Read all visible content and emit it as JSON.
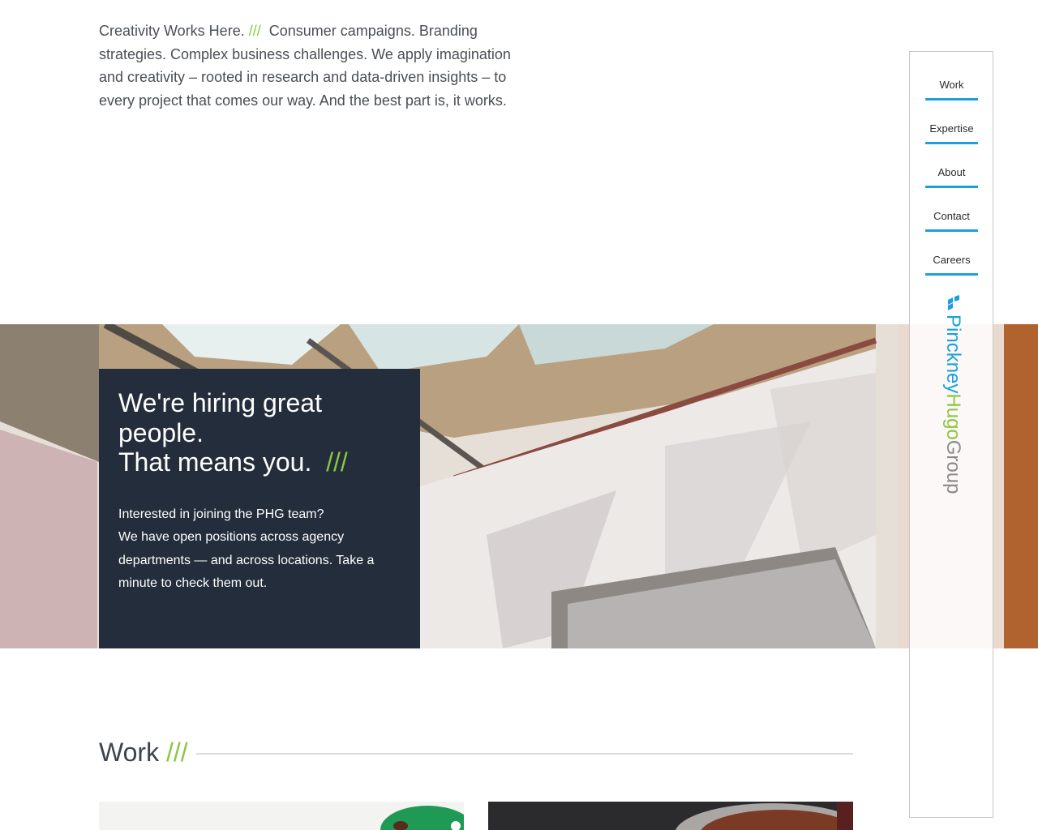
{
  "intro": {
    "lead": "Creativity Works Here.",
    "slashes": "///",
    "text": "Consumer campaigns. Branding strategies. Complex business challenges. We apply imagination and creativity – rooted in research and data-driven insights – to every project that comes our way. And the best part is, it works."
  },
  "hero": {
    "title_line1": "We're hiring great people.",
    "title_line2": "That means you.",
    "title_slashes": "///",
    "body_line1": "Interested in joining the PHG team?",
    "body_line2": "We have open positions across agency departments — and across locations. Take a minute to check them out."
  },
  "work": {
    "heading": "Work",
    "slashes": "///"
  },
  "nav": {
    "items": [
      {
        "label": "Work"
      },
      {
        "label": "Expertise"
      },
      {
        "label": "About"
      },
      {
        "label": "Contact"
      },
      {
        "label": "Careers"
      }
    ]
  },
  "brand": {
    "name_part1": "Pinckney",
    "name_part2": "Hugo",
    "name_part3": "Group"
  },
  "colors": {
    "accent_green": "#8cc63f",
    "accent_blue": "#1ba0dd",
    "card_navy": "#232d3b"
  }
}
